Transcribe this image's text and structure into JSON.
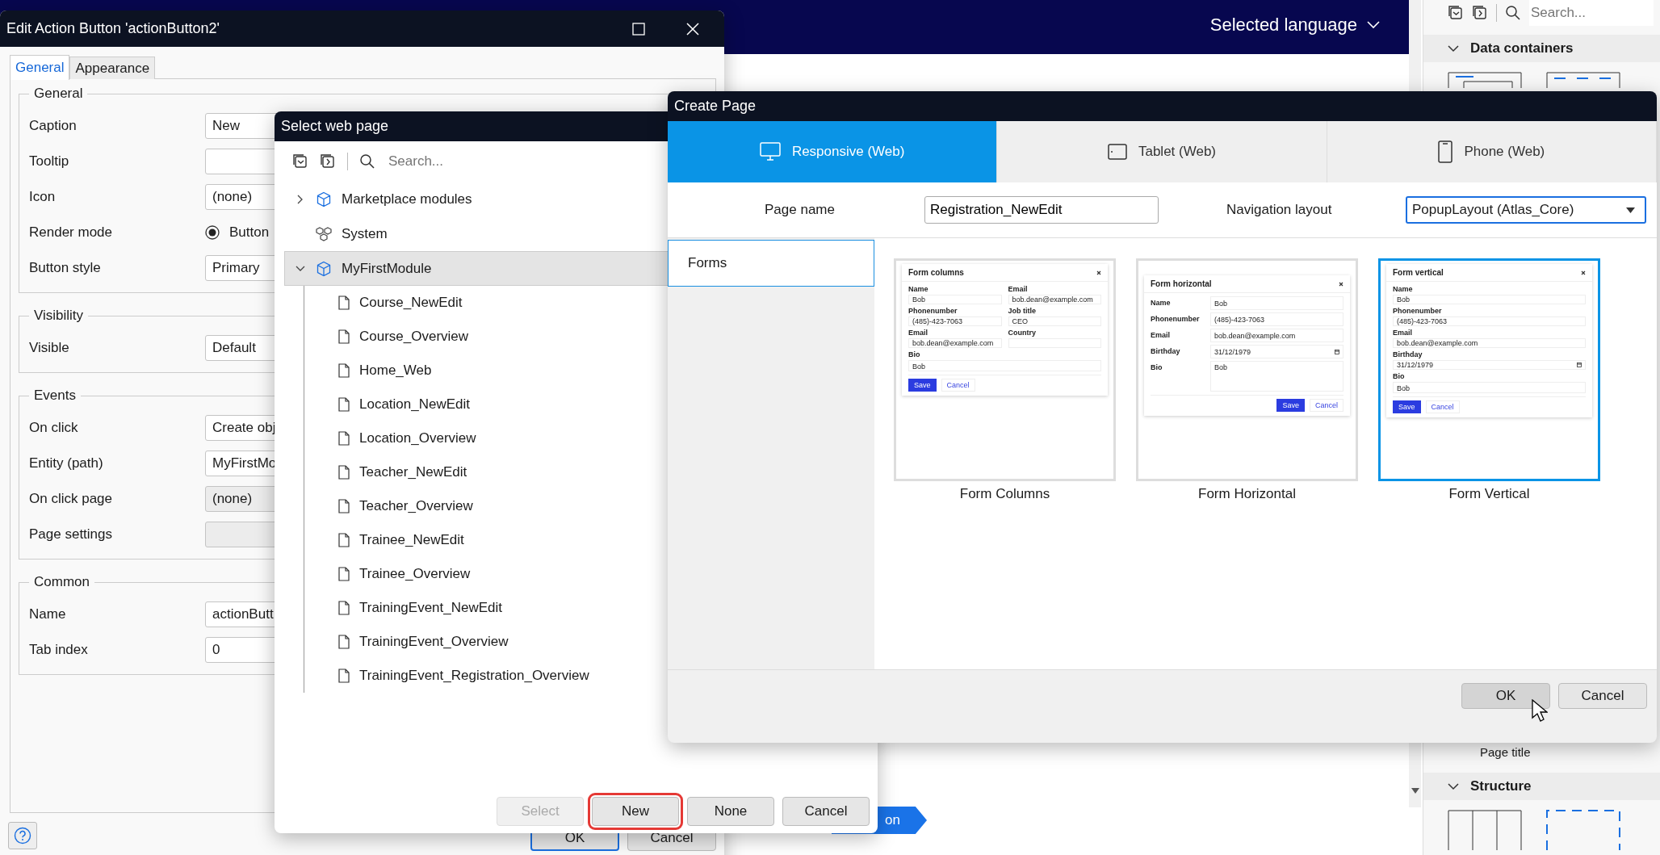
{
  "app_header": {
    "language_menu": "Selected language"
  },
  "toolbox": {
    "search": {
      "placeholder": "Search..."
    },
    "sections": [
      {
        "title": "Data containers",
        "expanded": true,
        "kind": "data"
      },
      {
        "title": "Structure",
        "expanded": true,
        "kind": "structure"
      }
    ],
    "item_label": "Page title"
  },
  "breadcrumb": {
    "label": "on"
  },
  "edit_dialog": {
    "title": "Edit Action Button 'actionButton2'",
    "tabs": [
      {
        "label": "General",
        "selected": true
      },
      {
        "label": "Appearance",
        "selected": false
      }
    ],
    "groups": [
      {
        "title": "General",
        "rows": [
          {
            "label": "Caption",
            "kind": "field",
            "value": "New",
            "disabled": false
          },
          {
            "label": "Tooltip",
            "kind": "field",
            "disabled": false
          },
          {
            "label": "Icon",
            "kind": "field",
            "value": "(none)",
            "disabled": false
          },
          {
            "label": "Render mode",
            "kind": "radio",
            "value": "Button",
            "checked": true
          },
          {
            "label": "Button style",
            "kind": "field",
            "value": "Primary",
            "disabled": false
          }
        ]
      },
      {
        "title": "Visibility",
        "rows": [
          {
            "label": "Visible",
            "kind": "field",
            "value": "Default",
            "disabled": false
          }
        ]
      },
      {
        "title": "Events",
        "rows": [
          {
            "label": "On click",
            "kind": "field",
            "value": "Create obj",
            "disabled": false
          },
          {
            "label": "Entity (path)",
            "kind": "field",
            "value": "MyFirstMo",
            "disabled": false
          },
          {
            "label": "On click page",
            "kind": "field",
            "value": "(none)",
            "disabled": true
          },
          {
            "label": "Page settings",
            "kind": "field",
            "disabled": true
          }
        ]
      },
      {
        "title": "Common",
        "rows": [
          {
            "label": "Name",
            "kind": "field",
            "value": "actionButt",
            "disabled": false
          },
          {
            "label": "Tab index",
            "kind": "field",
            "value": "0",
            "disabled": false
          }
        ]
      }
    ],
    "buttons": [
      {
        "label": "OK",
        "default": true
      },
      {
        "label": "Cancel",
        "default": false
      }
    ]
  },
  "select_dialog": {
    "title": "Select web page",
    "search": {
      "placeholder": "Search..."
    },
    "tree": [
      {
        "label": "Marketplace modules",
        "kind": "module",
        "expanded": false,
        "selected": false
      },
      {
        "label": "System",
        "kind": "system",
        "selected": false
      },
      {
        "label": "MyFirstModule",
        "kind": "module",
        "expanded": true,
        "selected": true,
        "children": [
          {
            "label": "Course_NewEdit"
          },
          {
            "label": "Course_Overview"
          },
          {
            "label": "Home_Web"
          },
          {
            "label": "Location_NewEdit"
          },
          {
            "label": "Location_Overview"
          },
          {
            "label": "Teacher_NewEdit"
          },
          {
            "label": "Teacher_Overview"
          },
          {
            "label": "Trainee_NewEdit"
          },
          {
            "label": "Trainee_Overview"
          },
          {
            "label": "TrainingEvent_NewEdit"
          },
          {
            "label": "TrainingEvent_Overview"
          },
          {
            "label": "TrainingEvent_Registration_Overview"
          }
        ]
      }
    ],
    "buttons": [
      {
        "label": "Select",
        "disabled": true,
        "highlighted": false
      },
      {
        "label": "New",
        "disabled": false,
        "highlighted": true
      },
      {
        "label": "None",
        "disabled": false,
        "highlighted": false
      },
      {
        "label": "Cancel",
        "disabled": false,
        "highlighted": false
      }
    ]
  },
  "create_dialog": {
    "title": "Create Page",
    "tabs": [
      {
        "label": "Responsive (Web)",
        "kind": "responsive",
        "selected": true
      },
      {
        "label": "Tablet (Web)",
        "kind": "tablet",
        "selected": false
      },
      {
        "label": "Phone (Web)",
        "kind": "phone",
        "selected": false
      }
    ],
    "page_name": {
      "label": "Page name",
      "value": "Registration_NewEdit"
    },
    "navigation_layout": {
      "label": "Navigation layout",
      "value": "PopupLayout (Atlas_Core)"
    },
    "categories": [
      {
        "label": "Forms",
        "selected": true
      }
    ],
    "templates": [
      {
        "caption": "Form Columns",
        "selected": false,
        "form": {
          "title": "Form columns",
          "kind": "columns",
          "fields": [
            {
              "label": "Name",
              "value": "Bob",
              "kind": "text"
            },
            {
              "label": "Email",
              "value": "bob.dean@example.com",
              "kind": "text"
            },
            {
              "label": "Phonenumber",
              "value": "(485)-423-7063",
              "kind": "text"
            },
            {
              "label": "Job title",
              "value": "CEO",
              "kind": "text"
            },
            {
              "label": "Email",
              "value": "bob.dean@example.com",
              "kind": "text"
            },
            {
              "label": "Country",
              "kind": "text"
            },
            {
              "label": "Bio",
              "value": "Bob",
              "kind": "textarea"
            }
          ],
          "buttons": [
            "Save",
            "Cancel"
          ]
        }
      },
      {
        "caption": "Form Horizontal",
        "selected": false,
        "form": {
          "title": "Form horizontal",
          "kind": "horizontal",
          "fields": [
            {
              "label": "Name",
              "value": "Bob",
              "kind": "text"
            },
            {
              "label": "Phonenumber",
              "value": "(485)-423-7063",
              "kind": "text"
            },
            {
              "label": "Email",
              "value": "bob.dean@example.com",
              "kind": "text"
            },
            {
              "label": "Birthday",
              "value": "31/12/1979",
              "kind": "date"
            },
            {
              "label": "Bio",
              "value": "Bob",
              "kind": "textarea"
            }
          ],
          "buttons": [
            "Save",
            "Cancel"
          ]
        }
      },
      {
        "caption": "Form Vertical",
        "selected": true,
        "form": {
          "title": "Form vertical",
          "kind": "vertical",
          "fields": [
            {
              "label": "Name",
              "value": "Bob",
              "kind": "text"
            },
            {
              "label": "Phonenumber",
              "value": "(485)-423-7063",
              "kind": "text"
            },
            {
              "label": "Email",
              "value": "bob.dean@example.com",
              "kind": "text"
            },
            {
              "label": "Birthday",
              "value": "31/12/1979",
              "kind": "date"
            },
            {
              "label": "Bio",
              "value": "Bob",
              "kind": "textarea"
            }
          ],
          "buttons": [
            "Save",
            "Cancel"
          ]
        }
      }
    ],
    "buttons": [
      {
        "label": "OK",
        "hovered": true
      },
      {
        "label": "Cancel",
        "hovered": false
      }
    ]
  }
}
